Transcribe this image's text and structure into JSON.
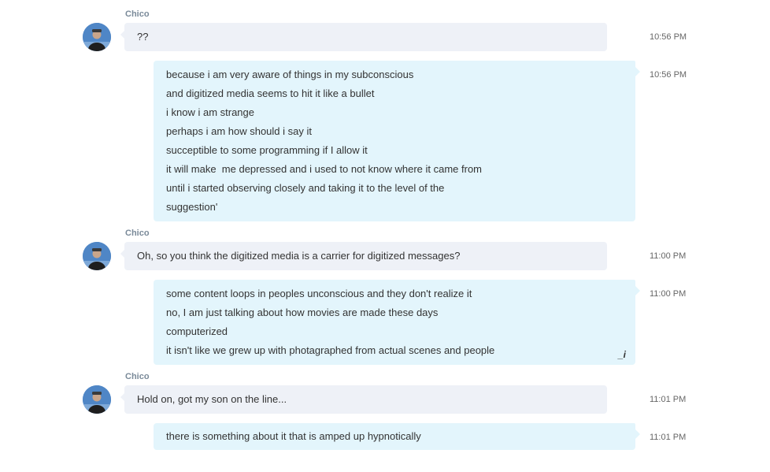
{
  "messages": [
    {
      "type": "incoming",
      "sender": "Chico",
      "lines": [
        "??"
      ],
      "time": "10:56 PM"
    },
    {
      "type": "outgoing",
      "lines": [
        "because i am very aware of things in my subconscious",
        "and digitized media seems to hit it like a bullet",
        "i know i am strange",
        "perhaps i am how should i say it",
        "succeptible to some programming if I allow it",
        "it will make  me depressed and i used to not know where it came from",
        "until i started observing closely and taking it to the level of the",
        "suggestion'"
      ],
      "time": "10:56 PM"
    },
    {
      "type": "incoming",
      "sender": "Chico",
      "lines": [
        "Oh, so you think the digitized media is a carrier for digitized messages?"
      ],
      "time": "11:00 PM"
    },
    {
      "type": "outgoing",
      "lines": [
        "some content loops in peoples unconscious and they don't realize it",
        "no, I am just talking about how movies are made these days",
        "computerized",
        "it isn't like we grew up with photagraphed from actual scenes and people"
      ],
      "time": "11:00 PM",
      "edited_marker": "_i"
    },
    {
      "type": "incoming",
      "sender": "Chico",
      "lines": [
        "Hold on, got my son on the line..."
      ],
      "time": "11:01 PM"
    },
    {
      "type": "outgoing",
      "lines": [
        "there is something about it that is amped up hypnotically"
      ],
      "time": "11:01 PM"
    }
  ],
  "colors": {
    "incoming_bubble": "#eef1f7",
    "outgoing_bubble": "#e3f5fc",
    "sender_name": "#7a8a99",
    "avatar_bg": "#4f86c6"
  },
  "icons": {
    "avatar": "user-avatar-photo",
    "edited": "edit-pencil-icon"
  }
}
